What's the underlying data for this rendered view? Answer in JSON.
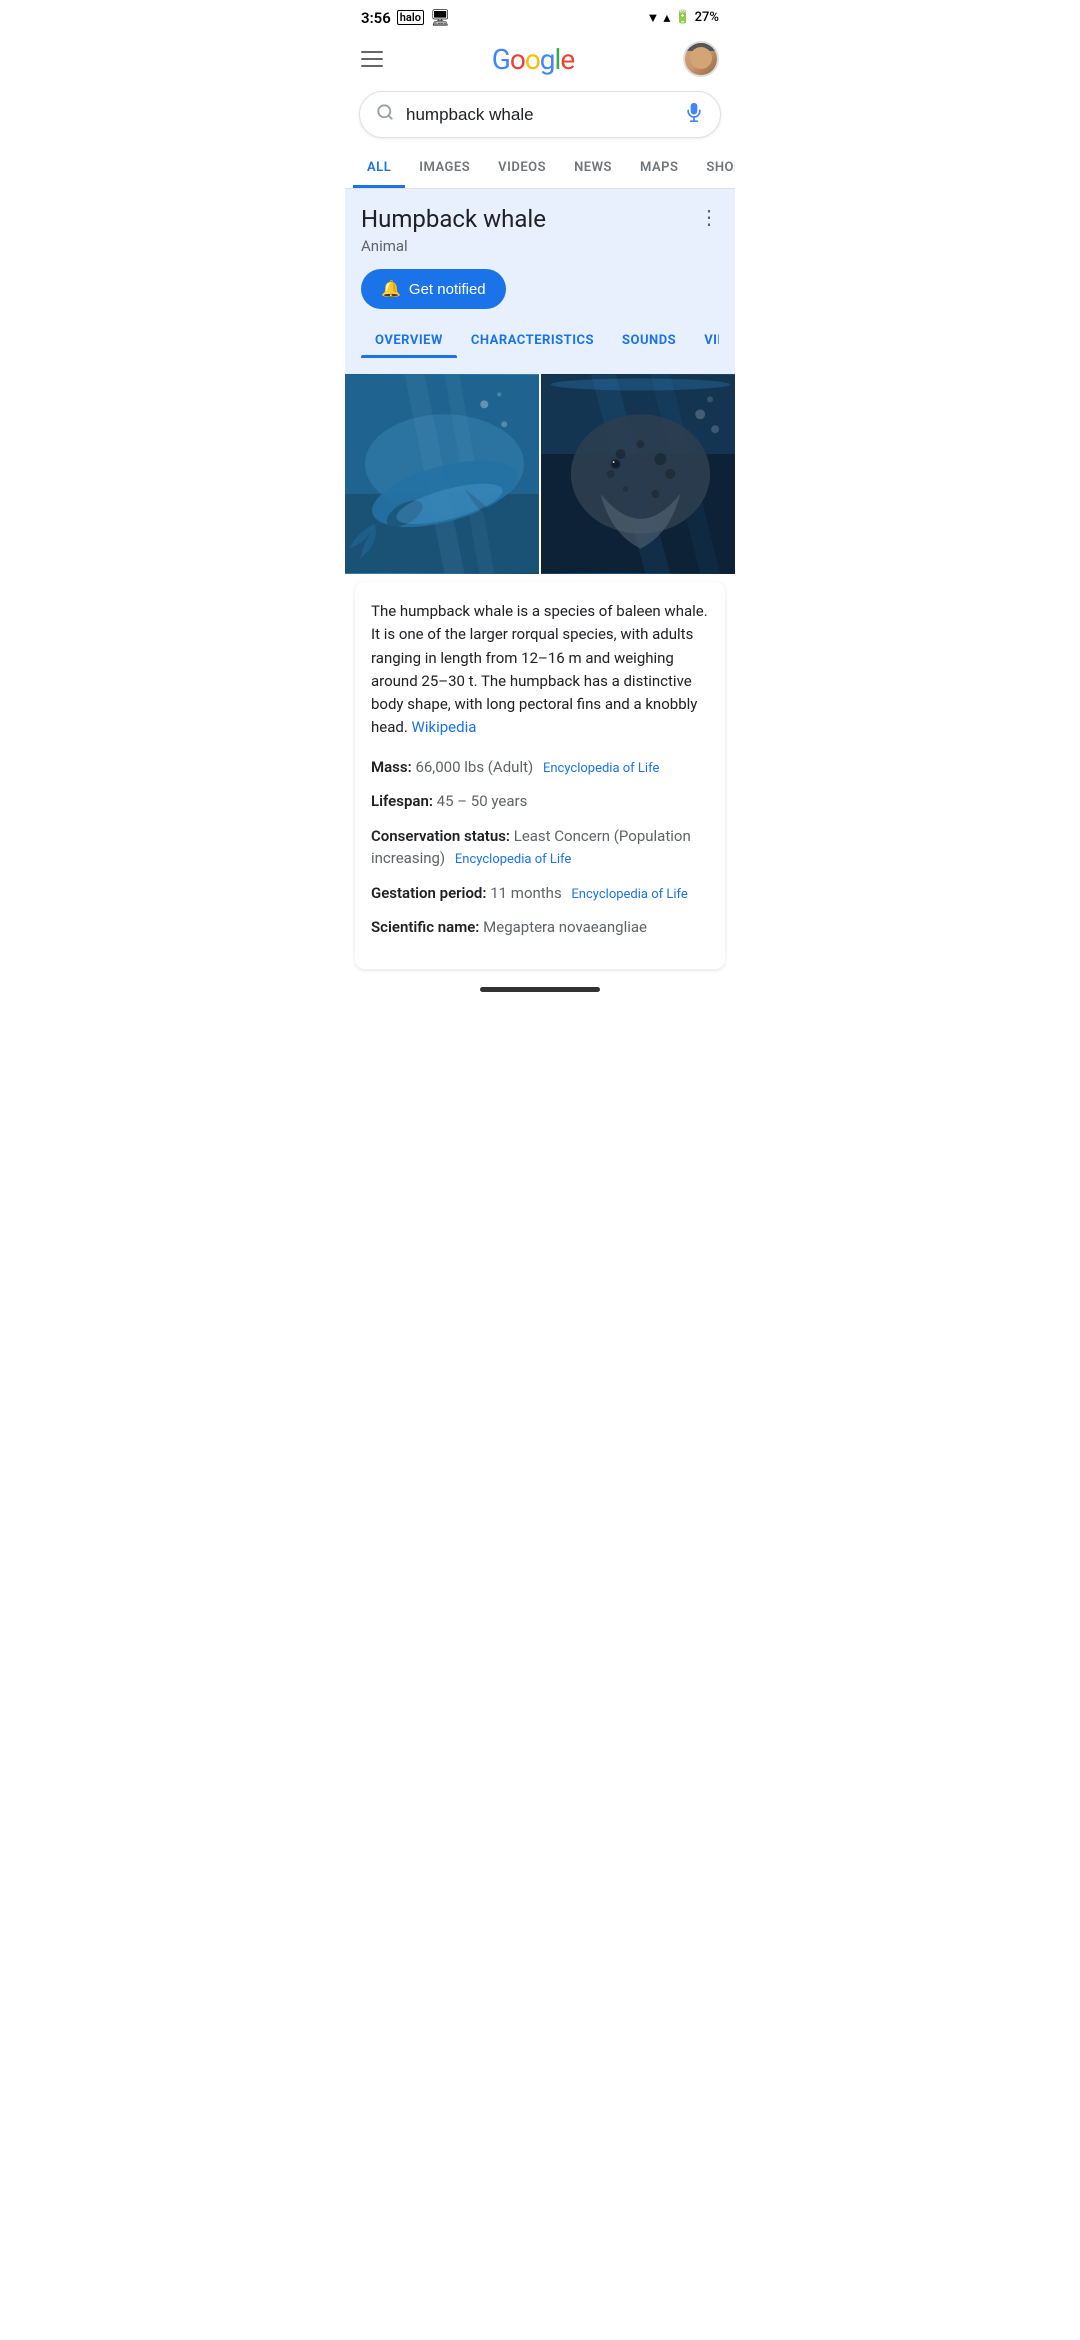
{
  "statusBar": {
    "time": "3:56",
    "battery": "27%"
  },
  "header": {
    "logoText": "Google",
    "menuLabel": "Menu"
  },
  "search": {
    "query": "humpback whale",
    "placeholder": "Search",
    "micLabel": "Voice search"
  },
  "tabs": [
    {
      "label": "ALL",
      "active": true
    },
    {
      "label": "IMAGES",
      "active": false
    },
    {
      "label": "VIDEOS",
      "active": false
    },
    {
      "label": "NEWS",
      "active": false
    },
    {
      "label": "MAPS",
      "active": false
    },
    {
      "label": "SHOP",
      "active": false
    }
  ],
  "knowledgePanel": {
    "title": "Humpback whale",
    "subtitle": "Animal",
    "getNotifiedLabel": "Get notified",
    "sectionTabs": [
      {
        "label": "OVERVIEW",
        "active": true
      },
      {
        "label": "CHARACTERISTICS",
        "active": false
      },
      {
        "label": "SOUNDS",
        "active": false
      },
      {
        "label": "VIDEOS",
        "active": false
      }
    ]
  },
  "infoBox": {
    "description": "The humpback whale is a species of baleen whale. It is one of the larger rorqual species, with adults ranging in length from 12–16 m and weighing around 25–30 t. The humpback has a distinctive body shape, with long pectoral fins and a knobbly head.",
    "wikiLabel": "Wikipedia",
    "facts": [
      {
        "label": "Mass:",
        "value": "66,000 lbs (Adult)",
        "source": "Encyclopedia of Life"
      },
      {
        "label": "Lifespan:",
        "value": "45 – 50 years",
        "source": ""
      },
      {
        "label": "Conservation status:",
        "value": "Least Concern (Population increasing)",
        "source": "Encyclopedia of Life"
      },
      {
        "label": "Gestation period:",
        "value": "11 months",
        "source": "Encyclopedia of Life"
      },
      {
        "label": "Scientific name:",
        "value": "Megaptera novaeangliae",
        "source": ""
      }
    ]
  }
}
